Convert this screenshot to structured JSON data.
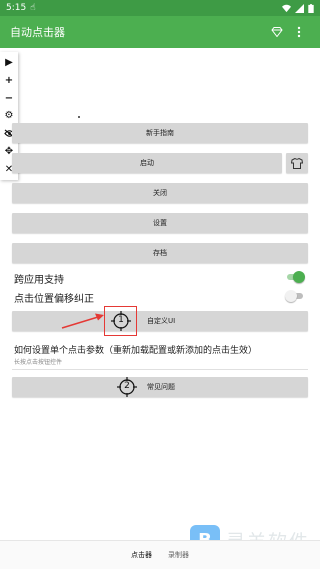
{
  "statusbar": {
    "time": "5:15"
  },
  "appbar": {
    "title": "自动点击器"
  },
  "floatbar": {
    "items": [
      {
        "icon": "play-icon",
        "glyph": "▶"
      },
      {
        "icon": "plus-icon",
        "glyph": "+"
      },
      {
        "icon": "minus-icon",
        "glyph": "−"
      },
      {
        "icon": "gear-icon",
        "glyph": "⚙"
      },
      {
        "icon": "eye-off-icon",
        "glyph": "⊘"
      },
      {
        "icon": "move-icon",
        "glyph": "✥"
      },
      {
        "icon": "close-icon",
        "glyph": "✕"
      }
    ]
  },
  "buttons": {
    "guide": "新手指南",
    "start": "启动",
    "close": "关闭",
    "settings": "设置",
    "archive": "存档",
    "custom_ui": "自定义UI",
    "faq": "常见问题"
  },
  "toggles": {
    "cross_app": {
      "label": "跨应用支持",
      "on": true
    },
    "offset": {
      "label": "点击位置偏移纠正",
      "on": false
    }
  },
  "tip": {
    "title": "如何设置单个点击参数（重新加载配置或新添加的点击生效）",
    "subtitle": "长按点击按钮控件"
  },
  "target_numbers": {
    "first": "1",
    "second": "2"
  },
  "bottom_nav": {
    "clicker": "点击器",
    "recorder": "录制器"
  },
  "watermark": {
    "text": "灵羊软件"
  },
  "colors": {
    "primary": "#4caf50",
    "switch_on": "#4caf50",
    "highlight": "#e53935"
  }
}
